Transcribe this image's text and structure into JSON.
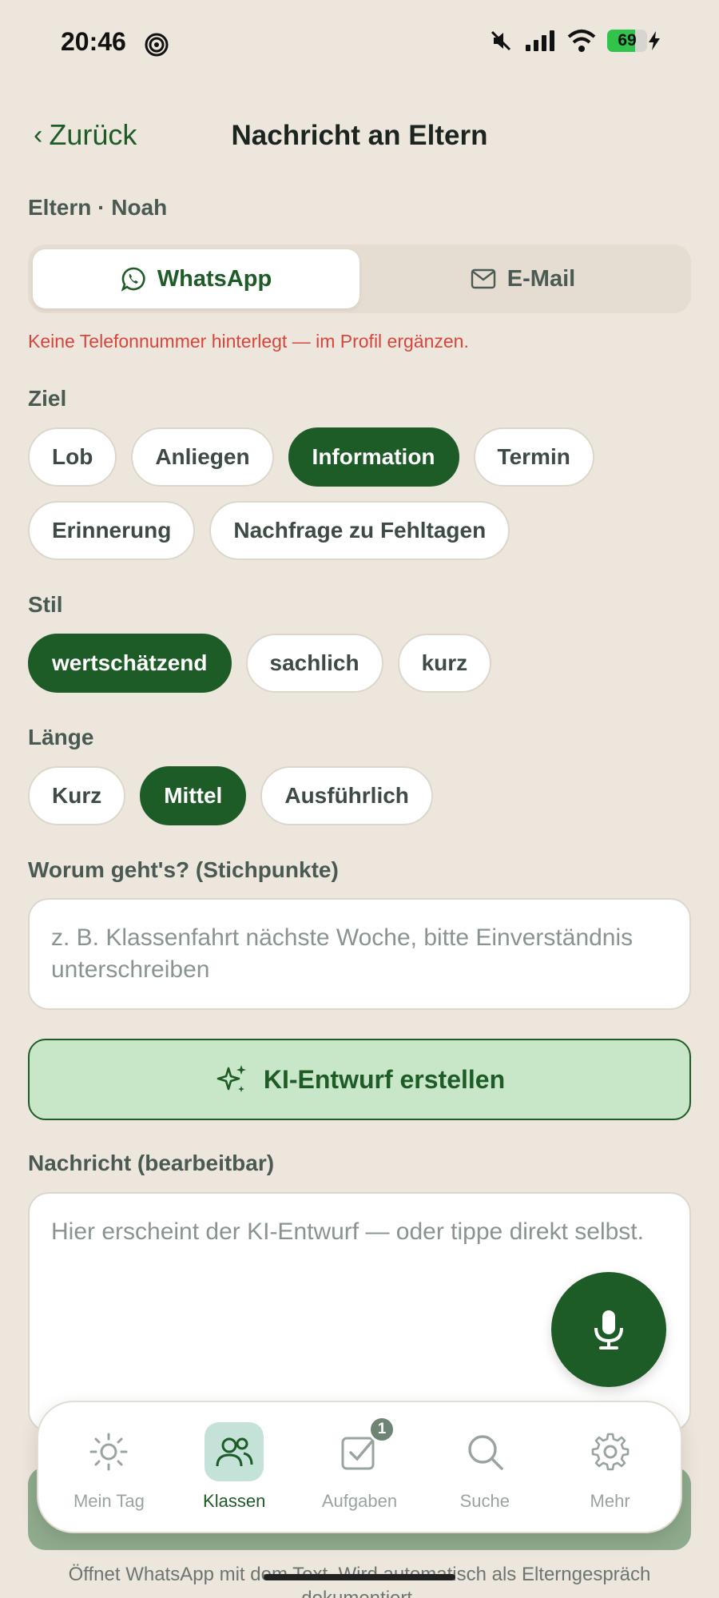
{
  "status_bar": {
    "time": "20:46",
    "battery": "69"
  },
  "nav": {
    "back_label": "Zurück",
    "title": "Nachricht an Eltern"
  },
  "recipient": "Eltern · Noah",
  "channel": {
    "options": [
      {
        "label": "WhatsApp",
        "icon": "whatsapp-icon"
      },
      {
        "label": "E-Mail",
        "icon": "mail-icon"
      }
    ],
    "selected": "WhatsApp"
  },
  "warning": "Keine Telefonnummer hinterlegt — im Profil ergänzen.",
  "goal": {
    "label": "Ziel",
    "options": [
      "Lob",
      "Anliegen",
      "Information",
      "Termin",
      "Erinnerung",
      "Nachfrage zu Fehltagen"
    ],
    "selected": "Information"
  },
  "style": {
    "label": "Stil",
    "options": [
      "wertschätzend",
      "sachlich",
      "kurz"
    ],
    "selected": "wertschätzend"
  },
  "length": {
    "label": "Länge",
    "options": [
      "Kurz",
      "Mittel",
      "Ausführlich"
    ],
    "selected": "Mittel"
  },
  "topic": {
    "label": "Worum geht's? (Stichpunkte)",
    "placeholder": "z. B. Klassenfahrt nächste Woche, bitte Einverständnis unterschreiben"
  },
  "ai_button": {
    "label": "KI-Entwurf erstellen",
    "icon": "sparkles-icon"
  },
  "message": {
    "label": "Nachricht (bearbeitbar)",
    "placeholder": "Hier erscheint der KI-Entwurf — oder tippe direkt selbst."
  },
  "footnote": "Öffnet WhatsApp mit dem Text. Wird automatisch als Elterngespräch dokumentiert.",
  "tabs": [
    {
      "label": "Mein Tag",
      "icon": "sun-icon"
    },
    {
      "label": "Klassen",
      "icon": "users-icon",
      "active": true
    },
    {
      "label": "Aufgaben",
      "icon": "checkbox-icon",
      "badge": "1"
    },
    {
      "label": "Suche",
      "icon": "search-icon"
    },
    {
      "label": "Mehr",
      "icon": "gear-icon"
    }
  ],
  "colors": {
    "accent": "#1e5c27",
    "background": "#ede6dd",
    "warning": "#d8453a",
    "ai_button_bg": "#c8e6c8"
  }
}
